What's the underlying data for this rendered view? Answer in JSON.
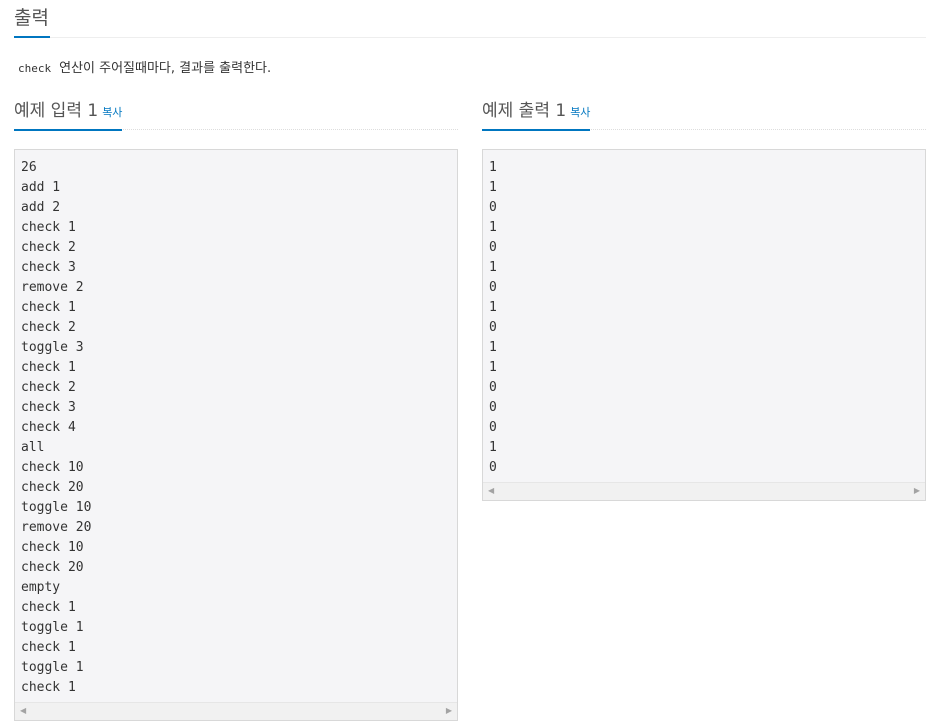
{
  "section": {
    "title": "출력"
  },
  "description": {
    "code": "check",
    "text": "연산이 주어질때마다, 결과를 출력한다."
  },
  "sample_input": {
    "title": "예제 입력 1",
    "copy_label": "복사",
    "lines": [
      "26",
      "add 1",
      "add 2",
      "check 1",
      "check 2",
      "check 3",
      "remove 2",
      "check 1",
      "check 2",
      "toggle 3",
      "check 1",
      "check 2",
      "check 3",
      "check 4",
      "all",
      "check 10",
      "check 20",
      "toggle 10",
      "remove 20",
      "check 10",
      "check 20",
      "empty",
      "check 1",
      "toggle 1",
      "check 1",
      "toggle 1",
      "check 1"
    ]
  },
  "sample_output": {
    "title": "예제 출력 1",
    "copy_label": "복사",
    "lines": [
      "1",
      "1",
      "0",
      "1",
      "0",
      "1",
      "0",
      "1",
      "0",
      "1",
      "1",
      "0",
      "0",
      "0",
      "1",
      "0"
    ]
  },
  "scrollbar": {
    "left_arrow": "◀",
    "right_arrow": "▶"
  }
}
